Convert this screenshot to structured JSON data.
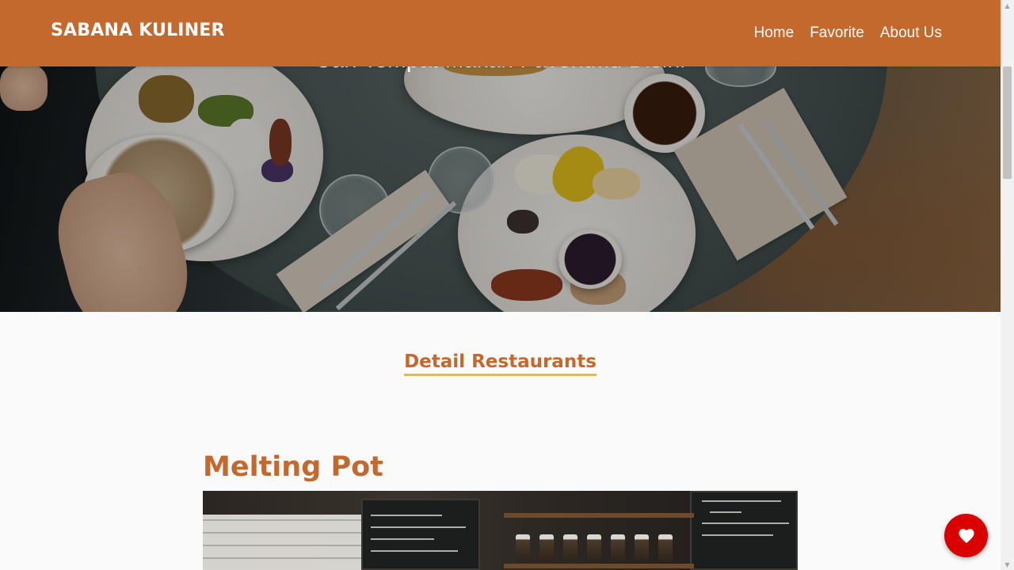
{
  "header": {
    "brand": "SABANA KULINER",
    "nav": [
      {
        "label": "Home"
      },
      {
        "label": "Favorite"
      },
      {
        "label": "About Us"
      }
    ]
  },
  "hero": {
    "tagline": "Cari Tempat Makan Favoritmu Disini"
  },
  "main": {
    "section_title": "Detail Restaurants",
    "restaurant": {
      "name": "Melting Pot"
    }
  },
  "favorite_button": {
    "icon": "heart-icon"
  },
  "colors": {
    "primary": "#c4692d",
    "accent_underline": "#e3b36a",
    "favorite": "#db0000"
  }
}
